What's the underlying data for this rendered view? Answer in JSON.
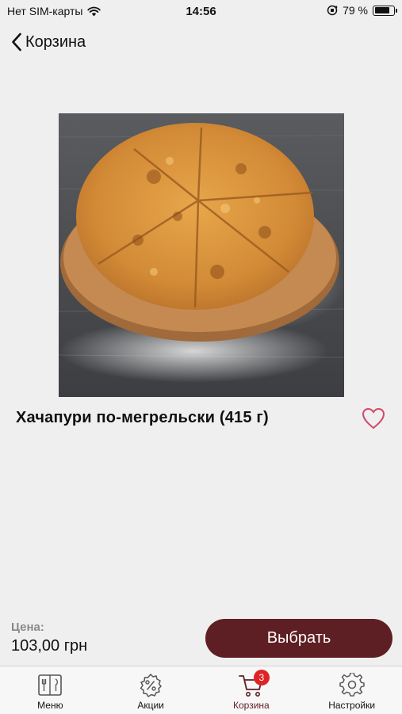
{
  "status_bar": {
    "carrier": "Нет SIM-карты",
    "time": "14:56",
    "battery_text": "79 %",
    "battery_level": 0.79
  },
  "nav": {
    "back_label": "Корзина"
  },
  "product": {
    "title": "Хачапури по-мегрельски (415 г)",
    "price_label": "Цена:",
    "price": "103,00 грн",
    "cta_label": "Выбрать"
  },
  "tabs": [
    {
      "label": "Меню",
      "icon": "menu-book-icon"
    },
    {
      "label": "Акции",
      "icon": "percent-gear-icon"
    },
    {
      "label": "Корзина",
      "icon": "cart-icon",
      "badge": "3"
    },
    {
      "label": "Настройки",
      "icon": "gear-icon"
    }
  ],
  "colors": {
    "accent": "#5e1f24",
    "favorite": "#d04a6a",
    "badge": "#e02424",
    "background": "#efefef"
  }
}
